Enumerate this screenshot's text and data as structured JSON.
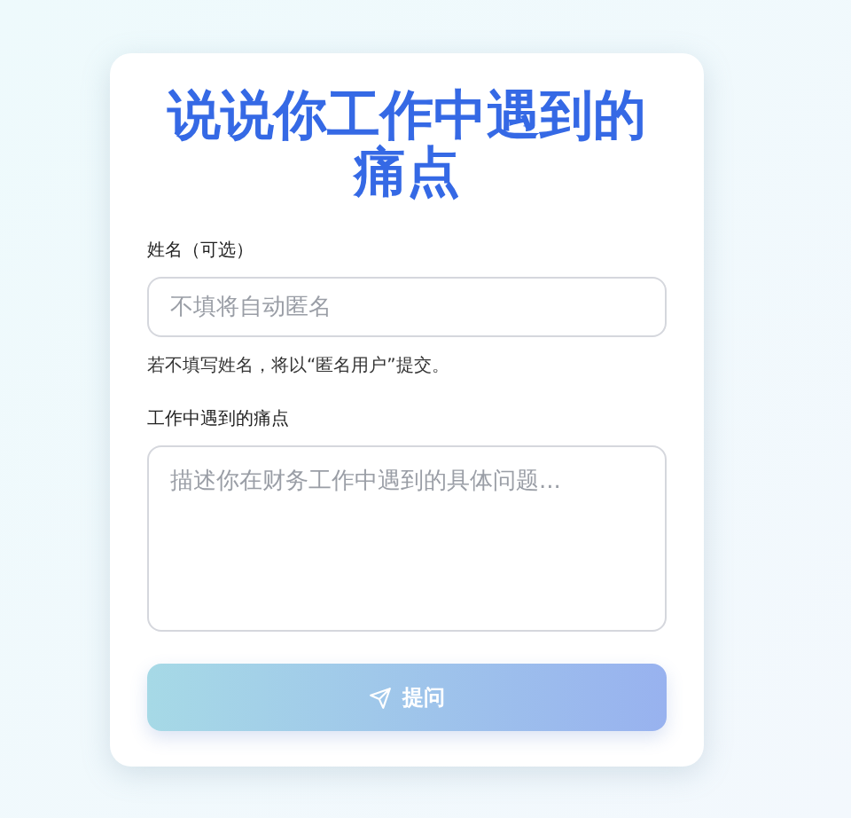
{
  "title": "说说你工作中遇到的痛点",
  "name_field": {
    "label": "姓名（可选）",
    "placeholder": "不填将自动匿名",
    "hint": "若不填写姓名，将以“匿名用户”提交。"
  },
  "pain_field": {
    "label": "工作中遇到的痛点",
    "placeholder": "描述你在财务工作中遇到的具体问题..."
  },
  "submit_button": {
    "label": "提问",
    "disabled": true
  }
}
